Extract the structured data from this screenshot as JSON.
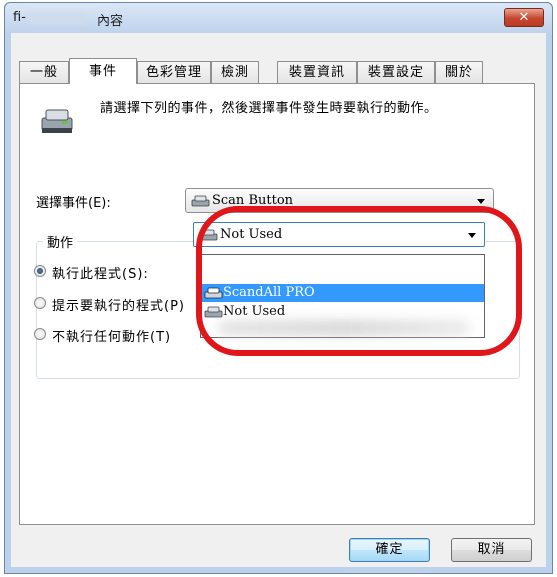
{
  "window": {
    "title_prefix": "fi-",
    "title_suffix": "內容",
    "close_label": "✕"
  },
  "tabs": [
    {
      "label": "一般",
      "active": false
    },
    {
      "label": "事件",
      "active": true
    },
    {
      "label": "色彩管理",
      "active": false
    },
    {
      "label": "檢測",
      "active": false
    },
    {
      "label": "裝置資訊",
      "active": false
    },
    {
      "label": "裝置設定",
      "active": false
    },
    {
      "label": "關於",
      "active": false
    }
  ],
  "events_tab": {
    "instruction": "請選擇下列的事件，然後選擇事件發生時要執行的動作。",
    "select_event_label": "選擇事件(E):",
    "selected_event": "Scan Button",
    "actions_group_label": "動作",
    "actions": {
      "run_program": {
        "label": "執行此程式(S):",
        "checked": true
      },
      "prompt_program": {
        "label": "提示要執行的程式(P)",
        "checked": false
      },
      "take_no_action": {
        "label": "不執行任何動作(T)",
        "checked": false
      }
    },
    "program_combo_value": "Not Used",
    "program_dropdown_items": [
      {
        "label": "ScandAll PRO",
        "selected": true
      },
      {
        "label": "Not Used",
        "selected": false
      }
    ]
  },
  "buttons": {
    "ok": "確定",
    "cancel": "取消"
  },
  "colors": {
    "highlight_ring": "#e0161b",
    "selection": "#3399ff",
    "close_button": "#c7462f"
  }
}
